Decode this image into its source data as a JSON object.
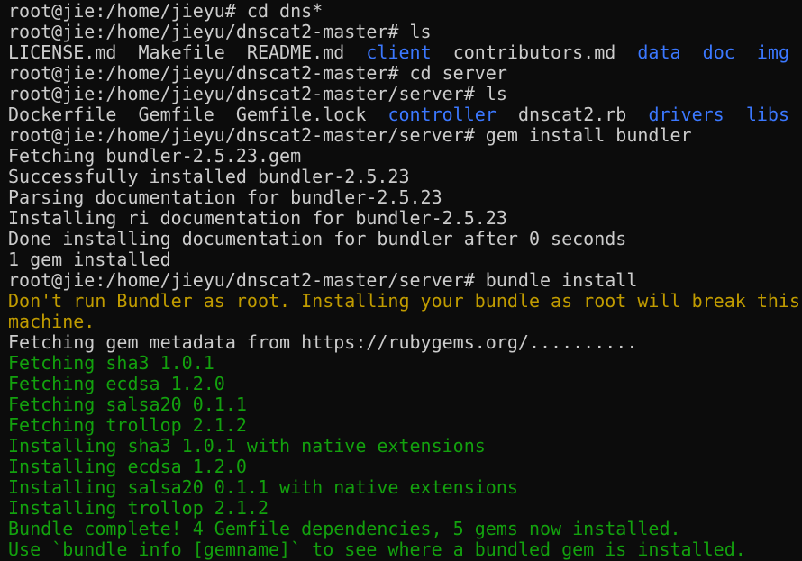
{
  "colors": {
    "background": "#0c0c0c",
    "default_text": "#cccccc",
    "directory": "#3b78ff",
    "warning": "#c19c00",
    "success": "#13a10e"
  },
  "terminal": {
    "lines": [
      {
        "segments": [
          {
            "text": "root@jie:/home/jieyu# cd dns*",
            "style": "default"
          }
        ]
      },
      {
        "segments": [
          {
            "text": "root@jie:/home/jieyu/dnscat2-master# ls",
            "style": "default"
          }
        ]
      },
      {
        "segments": [
          {
            "text": "LICENSE.md  Makefile  README.md  ",
            "style": "default"
          },
          {
            "text": "client",
            "style": "dir"
          },
          {
            "text": "  contributors.md  ",
            "style": "default"
          },
          {
            "text": "data",
            "style": "dir"
          },
          {
            "text": "  ",
            "style": "default"
          },
          {
            "text": "doc",
            "style": "dir"
          },
          {
            "text": "  ",
            "style": "default"
          },
          {
            "text": "img",
            "style": "dir"
          }
        ]
      },
      {
        "segments": [
          {
            "text": "root@jie:/home/jieyu/dnscat2-master# cd server",
            "style": "default"
          }
        ]
      },
      {
        "segments": [
          {
            "text": "root@jie:/home/jieyu/dnscat2-master/server# ls",
            "style": "default"
          }
        ]
      },
      {
        "segments": [
          {
            "text": "Dockerfile  Gemfile  Gemfile.lock  ",
            "style": "default"
          },
          {
            "text": "controller",
            "style": "dir"
          },
          {
            "text": "  dnscat2.rb  ",
            "style": "default"
          },
          {
            "text": "drivers",
            "style": "dir"
          },
          {
            "text": "  ",
            "style": "default"
          },
          {
            "text": "libs",
            "style": "dir"
          }
        ]
      },
      {
        "segments": [
          {
            "text": "root@jie:/home/jieyu/dnscat2-master/server# gem install bundler",
            "style": "default"
          }
        ]
      },
      {
        "segments": [
          {
            "text": "Fetching bundler-2.5.23.gem",
            "style": "default"
          }
        ]
      },
      {
        "segments": [
          {
            "text": "Successfully installed bundler-2.5.23",
            "style": "default"
          }
        ]
      },
      {
        "segments": [
          {
            "text": "Parsing documentation for bundler-2.5.23",
            "style": "default"
          }
        ]
      },
      {
        "segments": [
          {
            "text": "Installing ri documentation for bundler-2.5.23",
            "style": "default"
          }
        ]
      },
      {
        "segments": [
          {
            "text": "Done installing documentation for bundler after 0 seconds",
            "style": "default"
          }
        ]
      },
      {
        "segments": [
          {
            "text": "1 gem installed",
            "style": "default"
          }
        ]
      },
      {
        "segments": [
          {
            "text": "root@jie:/home/jieyu/dnscat2-master/server# bundle install",
            "style": "default"
          }
        ]
      },
      {
        "segments": [
          {
            "text": "Don't run Bundler as root. Installing your bundle as root will break this",
            "style": "warning"
          }
        ]
      },
      {
        "segments": [
          {
            "text": "machine.",
            "style": "warning"
          }
        ]
      },
      {
        "segments": [
          {
            "text": "Fetching gem metadata from https://rubygems.org/..........",
            "style": "default"
          }
        ]
      },
      {
        "segments": [
          {
            "text": "Fetching sha3 1.0.1",
            "style": "success"
          }
        ]
      },
      {
        "segments": [
          {
            "text": "Fetching ecdsa 1.2.0",
            "style": "success"
          }
        ]
      },
      {
        "segments": [
          {
            "text": "Fetching salsa20 0.1.1",
            "style": "success"
          }
        ]
      },
      {
        "segments": [
          {
            "text": "Fetching trollop 2.1.2",
            "style": "success"
          }
        ]
      },
      {
        "segments": [
          {
            "text": "Installing sha3 1.0.1 with native extensions",
            "style": "success"
          }
        ]
      },
      {
        "segments": [
          {
            "text": "Installing ecdsa 1.2.0",
            "style": "success"
          }
        ]
      },
      {
        "segments": [
          {
            "text": "Installing salsa20 0.1.1 with native extensions",
            "style": "success"
          }
        ]
      },
      {
        "segments": [
          {
            "text": "Installing trollop 2.1.2",
            "style": "success"
          }
        ]
      },
      {
        "segments": [
          {
            "text": "Bundle complete! 4 Gemfile dependencies, 5 gems now installed.",
            "style": "success"
          }
        ]
      },
      {
        "segments": [
          {
            "text": "Use `bundle info [gemname]` to see where a bundled gem is installed.",
            "style": "success"
          }
        ]
      }
    ]
  }
}
